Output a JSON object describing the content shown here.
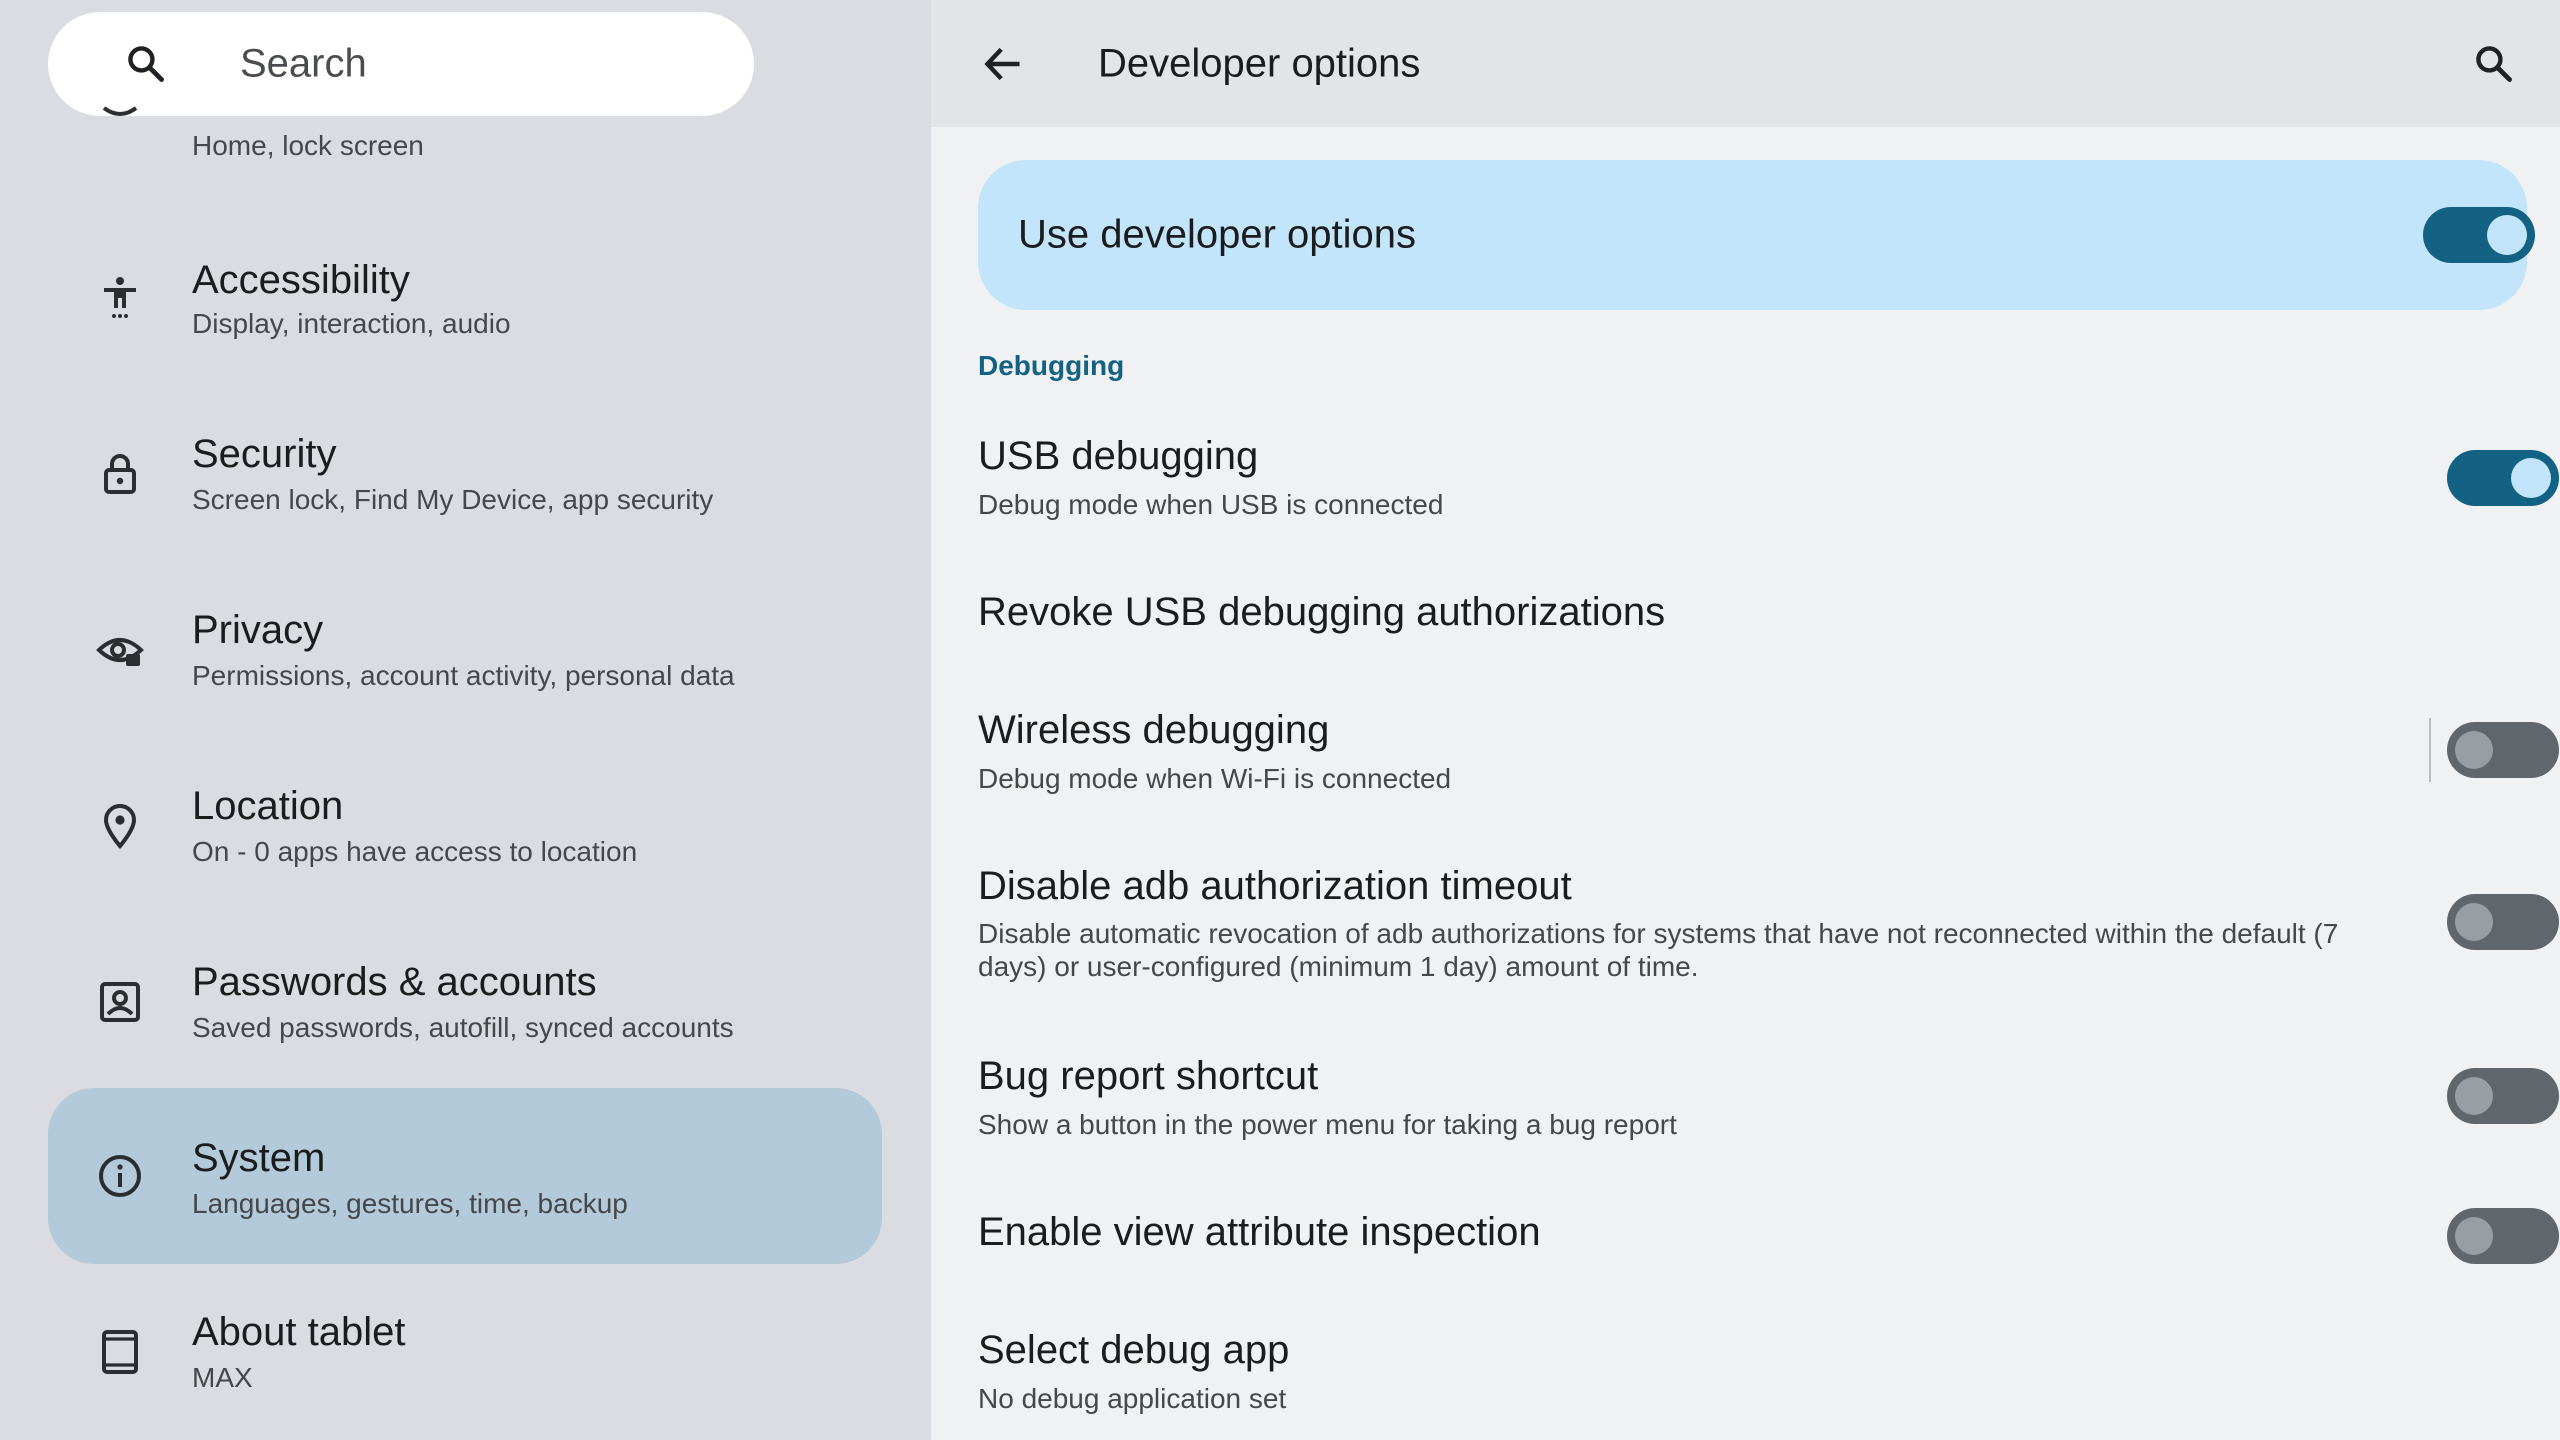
{
  "sidebar": {
    "search": {
      "label": "Search",
      "icon": "search-icon"
    },
    "partial_item": {
      "subtitle": "Home, lock screen",
      "icon": "wallpaper-icon"
    },
    "items": [
      {
        "title": "Accessibility",
        "subtitle": "Display, interaction, audio",
        "icon": "accessibility-icon"
      },
      {
        "title": "Security",
        "subtitle": "Screen lock, Find My Device, app security",
        "icon": "lock-icon"
      },
      {
        "title": "Privacy",
        "subtitle": "Permissions, account activity, personal data",
        "icon": "privacy-eye-icon"
      },
      {
        "title": "Location",
        "subtitle": "On - 0 apps have access to location",
        "icon": "location-pin-icon"
      },
      {
        "title": "Passwords & accounts",
        "subtitle": "Saved passwords, autofill, synced accounts",
        "icon": "account-box-icon"
      },
      {
        "title": "System",
        "subtitle": "Languages, gestures, time, backup",
        "icon": "info-icon",
        "selected": true
      },
      {
        "title": "About tablet",
        "subtitle": "MAX",
        "icon": "tablet-icon"
      }
    ]
  },
  "header": {
    "title": "Developer options",
    "back_icon": "arrow-back-icon",
    "search_icon": "search-icon"
  },
  "master_switch": {
    "label": "Use developer options",
    "checked": true
  },
  "section": {
    "title": "Debugging"
  },
  "settings": [
    {
      "title": "USB debugging",
      "subtitle": "Debug mode when USB is connected",
      "toggle": true,
      "checked": true
    },
    {
      "title": "Revoke USB debugging authorizations",
      "subtitle": "",
      "toggle": false
    },
    {
      "title": "Wireless debugging",
      "subtitle": "Debug mode when Wi-Fi is connected",
      "toggle": true,
      "checked": false
    },
    {
      "title": "Disable adb authorization timeout",
      "subtitle": "Disable automatic revocation of adb authorizations for systems that have not reconnected within the default (7 days) or user-configured (minimum 1 day) amount of time.",
      "toggle": true,
      "checked": false
    },
    {
      "title": "Bug report shortcut",
      "subtitle": "Show a button in the power menu for taking a bug report",
      "toggle": true,
      "checked": false
    },
    {
      "title": "Enable view attribute inspection",
      "subtitle": "",
      "toggle": true,
      "checked": false
    },
    {
      "title": "Select debug app",
      "subtitle": "No debug application set",
      "toggle": false
    }
  ],
  "colors": {
    "accent": "#136283",
    "master_card": "#c2e5fb",
    "selected_nav": "#b3cadb",
    "left_pane": "#dadce1",
    "right_pane": "#f0f1f3"
  }
}
